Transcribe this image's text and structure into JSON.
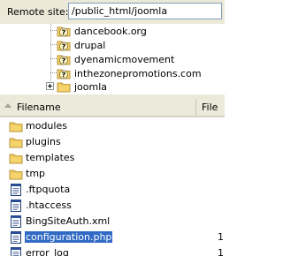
{
  "remote": {
    "label": "Remote site:",
    "path": "/public_html/joomla"
  },
  "tree": {
    "items": [
      {
        "label": "dancebook.org",
        "icon": "unknown-folder-icon"
      },
      {
        "label": "drupal",
        "icon": "unknown-folder-icon"
      },
      {
        "label": "dyenamicmovement",
        "icon": "unknown-folder-icon"
      },
      {
        "label": "inthezonepromotions.com",
        "icon": "unknown-folder-icon"
      },
      {
        "label": "joomla",
        "icon": "folder-icon",
        "expander": "+"
      }
    ]
  },
  "columns": {
    "filename": "Filename",
    "filesize": "File"
  },
  "files": [
    {
      "name": "modules",
      "type": "folder",
      "size": ""
    },
    {
      "name": "plugins",
      "type": "folder",
      "size": ""
    },
    {
      "name": "templates",
      "type": "folder",
      "size": ""
    },
    {
      "name": "tmp",
      "type": "folder",
      "size": ""
    },
    {
      "name": ".ftpquota",
      "type": "file",
      "size": ""
    },
    {
      "name": ".htaccess",
      "type": "file",
      "size": ""
    },
    {
      "name": "BingSiteAuth.xml",
      "type": "file",
      "size": ""
    },
    {
      "name": "configuration.php",
      "type": "file",
      "size": "1",
      "selected": true
    },
    {
      "name": "error_log",
      "type": "file",
      "size": "1"
    }
  ],
  "colors": {
    "selection": "#316ac5",
    "folder": "#f7d56b",
    "chrome": "#ece9d8"
  }
}
